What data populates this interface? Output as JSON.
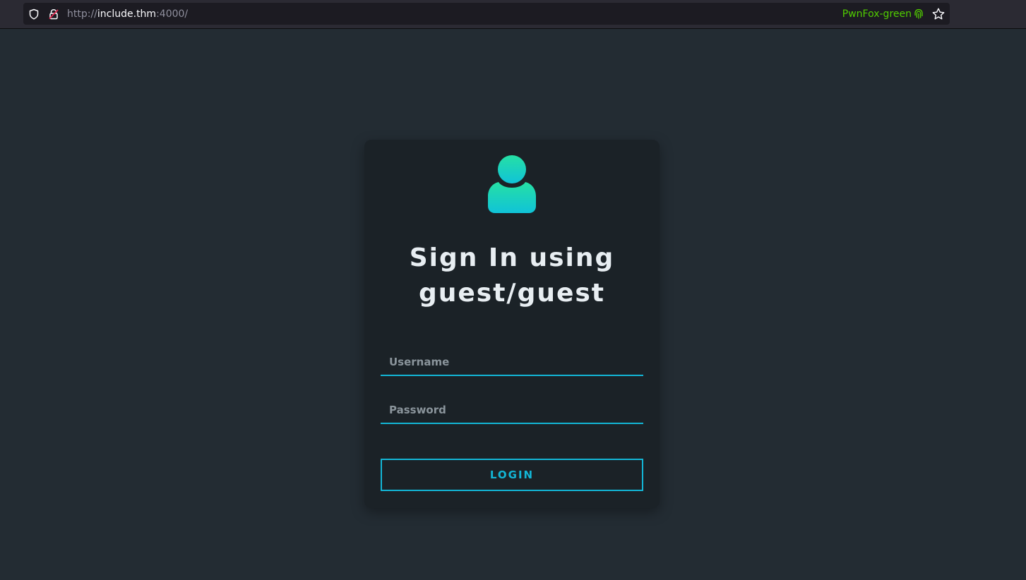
{
  "browser": {
    "url_scheme": "http://",
    "url_host": "include.thm",
    "url_rest": ":4000/",
    "container_label": "PwnFox-green",
    "container_color": "#51cd00",
    "icons": [
      "shield-icon",
      "insecure-lock-icon",
      "fingerprint-icon",
      "star-icon"
    ]
  },
  "login": {
    "title": "Sign In using guest/guest",
    "username_placeholder": "Username",
    "password_placeholder": "Password",
    "login_label": "LOGIN",
    "avatar_icon": "user-avatar-icon",
    "accent_color": "#13b6d6"
  }
}
